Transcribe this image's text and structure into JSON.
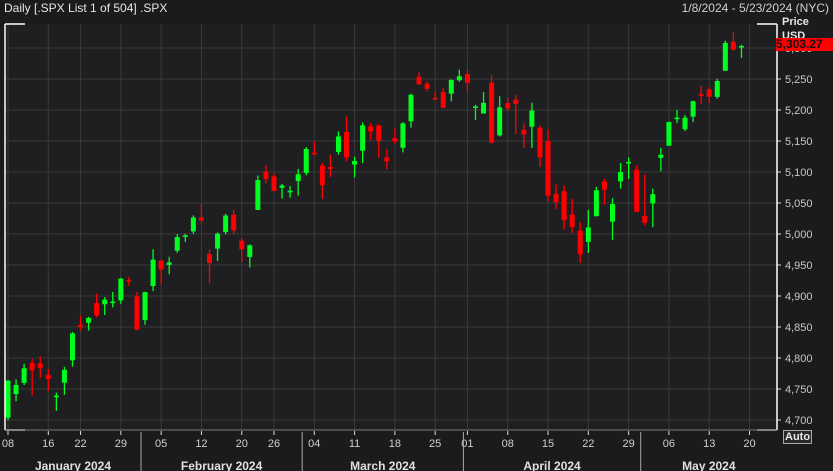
{
  "header": {
    "title": "Daily [.SPX List 1 of 504] .SPX",
    "date_range": "1/8/2024 - 5/23/2024 (NYC)"
  },
  "price_axis": {
    "title": "Price",
    "unit": "USD",
    "last_price": "5,303.27",
    "auto_label": "Auto"
  },
  "colors": {
    "up": "#00ff1e",
    "down": "#ff0000",
    "background": "#1f1f21",
    "grid": "#3a3a3a",
    "last_tag": "#ff0000"
  },
  "chart_data": {
    "type": "candlestick",
    "ylim": [
      4690,
      5330
    ],
    "y_ticks": [
      "4,700",
      "4,750",
      "4,800",
      "4,850",
      "4,900",
      "4,950",
      "5,000",
      "5,050",
      "5,100",
      "5,150",
      "5,200",
      "5,250",
      "5,300"
    ],
    "y_tick_values": [
      4700,
      4750,
      4800,
      4850,
      4900,
      4950,
      5000,
      5050,
      5100,
      5150,
      5200,
      5250,
      5300
    ],
    "x_ticks": [
      {
        "label": "08",
        "date": "2024-01-08"
      },
      {
        "label": "16",
        "date": "2024-01-16"
      },
      {
        "label": "22",
        "date": "2024-01-22"
      },
      {
        "label": "29",
        "date": "2024-01-29"
      },
      {
        "label": "05",
        "date": "2024-02-05"
      },
      {
        "label": "12",
        "date": "2024-02-12"
      },
      {
        "label": "20",
        "date": "2024-02-20"
      },
      {
        "label": "26",
        "date": "2024-02-26"
      },
      {
        "label": "04",
        "date": "2024-03-04"
      },
      {
        "label": "11",
        "date": "2024-03-11"
      },
      {
        "label": "18",
        "date": "2024-03-18"
      },
      {
        "label": "25",
        "date": "2024-03-25"
      },
      {
        "label": "01",
        "date": "2024-04-01"
      },
      {
        "label": "08",
        "date": "2024-04-08"
      },
      {
        "label": "15",
        "date": "2024-04-15"
      },
      {
        "label": "22",
        "date": "2024-04-22"
      },
      {
        "label": "29",
        "date": "2024-04-29"
      },
      {
        "label": "06",
        "date": "2024-05-06"
      },
      {
        "label": "13",
        "date": "2024-05-13"
      },
      {
        "label": "20",
        "date": "2024-05-20"
      }
    ],
    "months": [
      {
        "label": "January 2024",
        "from": "2024-01-08"
      },
      {
        "label": "February 2024",
        "from": "2024-02-01"
      },
      {
        "label": "March 2024",
        "from": "2024-03-01"
      },
      {
        "label": "April 2024",
        "from": "2024-04-01"
      },
      {
        "label": "May 2024",
        "from": "2024-05-01"
      }
    ],
    "candles": [
      [
        "2024-01-08",
        4703.7,
        4764.5,
        4699.8,
        4763.5
      ],
      [
        "2024-01-09",
        4741.9,
        4765.5,
        4730.4,
        4756.5
      ],
      [
        "2024-01-10",
        4759.9,
        4790.8,
        4756.2,
        4783.5
      ],
      [
        "2024-01-11",
        4792.1,
        4798.5,
        4739.6,
        4780.2
      ],
      [
        "2024-01-12",
        4791.2,
        4802.4,
        4768.0,
        4783.8
      ],
      [
        "2024-01-16",
        4772.4,
        4782.3,
        4747.1,
        4766.0
      ],
      [
        "2024-01-17",
        4739.1,
        4744.2,
        4714.8,
        4739.2
      ],
      [
        "2024-01-18",
        4760.1,
        4785.8,
        4740.6,
        4780.9
      ],
      [
        "2024-01-19",
        4796.3,
        4842.1,
        4785.9,
        4839.8
      ],
      [
        "2024-01-22",
        4853.4,
        4868.4,
        4844.1,
        4850.4
      ],
      [
        "2024-01-23",
        4856.8,
        4866.5,
        4844.4,
        4864.6
      ],
      [
        "2024-01-24",
        4888.6,
        4903.7,
        4865.9,
        4868.6
      ],
      [
        "2024-01-25",
        4886.7,
        4898.2,
        4869.3,
        4894.2
      ],
      [
        "2024-01-26",
        4888.9,
        4906.7,
        4881.5,
        4891.0
      ],
      [
        "2024-01-29",
        4892.9,
        4929.3,
        4887.4,
        4927.9
      ],
      [
        "2024-01-30",
        4925.9,
        4931.1,
        4916.3,
        4925.0
      ],
      [
        "2024-01-31",
        4899.2,
        4906.8,
        4845.2,
        4845.7
      ],
      [
        "2024-02-01",
        4861.1,
        4907.0,
        4853.5,
        4906.2
      ],
      [
        "2024-02-02",
        4916.1,
        4975.3,
        4908.0,
        4958.6
      ],
      [
        "2024-02-05",
        4957.2,
        4957.8,
        4918.1,
        4942.8
      ],
      [
        "2024-02-06",
        4950.2,
        4963.1,
        4934.9,
        4954.2
      ],
      [
        "2024-02-07",
        4973.1,
        4999.9,
        4969.7,
        4995.1
      ],
      [
        "2024-02-08",
        4995.2,
        5000.4,
        4987.1,
        4997.9
      ],
      [
        "2024-02-09",
        5004.2,
        5030.1,
        5000.3,
        5026.6
      ],
      [
        "2024-02-12",
        5026.8,
        5048.4,
        5016.7,
        5021.8
      ],
      [
        "2024-02-13",
        4967.9,
        4975.3,
        4920.3,
        4953.2
      ],
      [
        "2024-02-14",
        4976.4,
        5002.5,
        4956.4,
        5000.6
      ],
      [
        "2024-02-15",
        5003.1,
        5032.7,
        4999.4,
        5029.7
      ],
      [
        "2024-02-16",
        5031.1,
        5038.7,
        4999.5,
        5005.6
      ],
      [
        "2024-02-20",
        4989.3,
        4993.6,
        4955.0,
        4975.5
      ],
      [
        "2024-02-21",
        4963.0,
        4983.2,
        4946.0,
        4981.8
      ],
      [
        "2024-02-22",
        5038.8,
        5094.4,
        5038.8,
        5087.0
      ],
      [
        "2024-02-23",
        5100.9,
        5111.1,
        5081.5,
        5088.8
      ],
      [
        "2024-02-26",
        5093.0,
        5097.7,
        5068.9,
        5069.5
      ],
      [
        "2024-02-27",
        5074.6,
        5080.7,
        5057.3,
        5078.2
      ],
      [
        "2024-02-28",
        5067.2,
        5077.4,
        5058.4,
        5069.8
      ],
      [
        "2024-02-29",
        5085.4,
        5105.0,
        5061.9,
        5096.3
      ],
      [
        "2024-03-01",
        5098.5,
        5140.3,
        5094.5,
        5137.1
      ],
      [
        "2024-03-04",
        5131.0,
        5149.7,
        5127.2,
        5130.95
      ],
      [
        "2024-03-05",
        5110.5,
        5114.6,
        5056.8,
        5078.7
      ],
      [
        "2024-03-06",
        5108.0,
        5128.0,
        5092.2,
        5104.8
      ],
      [
        "2024-03-07",
        5132.4,
        5165.6,
        5128.2,
        5157.4
      ],
      [
        "2024-03-08",
        5164.5,
        5189.3,
        5117.5,
        5123.7
      ],
      [
        "2024-03-11",
        5112.0,
        5124.7,
        5091.1,
        5117.9
      ],
      [
        "2024-03-12",
        5134.3,
        5179.9,
        5114.5,
        5175.3
      ],
      [
        "2024-03-13",
        5173.5,
        5179.1,
        5151.9,
        5165.3
      ],
      [
        "2024-03-14",
        5175.1,
        5176.9,
        5123.3,
        5150.5
      ],
      [
        "2024-03-15",
        5123.3,
        5136.9,
        5104.4,
        5117.1
      ],
      [
        "2024-03-18",
        5154.8,
        5170.0,
        5145.5,
        5149.4
      ],
      [
        "2024-03-19",
        5139.1,
        5180.3,
        5131.6,
        5178.5
      ],
      [
        "2024-03-20",
        5181.7,
        5226.2,
        5171.6,
        5224.6
      ],
      [
        "2024-03-21",
        5253.4,
        5261.1,
        5240.7,
        5241.5
      ],
      [
        "2024-03-22",
        5242.5,
        5246.1,
        5229.9,
        5234.2
      ],
      [
        "2024-03-25",
        5219.5,
        5229.1,
        5216.1,
        5218.2
      ],
      [
        "2024-03-26",
        5228.9,
        5235.2,
        5203.4,
        5203.6
      ],
      [
        "2024-03-27",
        5226.3,
        5249.3,
        5213.9,
        5248.5
      ],
      [
        "2024-03-28",
        5248.0,
        5264.9,
        5245.8,
        5254.4
      ],
      [
        "2024-04-01",
        5258.0,
        5264.0,
        5229.2,
        5243.8
      ],
      [
        "2024-04-02",
        5204.3,
        5208.3,
        5184.1,
        5205.8
      ],
      [
        "2024-04-03",
        5194.4,
        5228.8,
        5194.4,
        5211.5
      ],
      [
        "2024-04-04",
        5244.1,
        5256.6,
        5146.1,
        5147.2
      ],
      [
        "2024-04-05",
        5159.0,
        5222.2,
        5157.2,
        5204.3
      ],
      [
        "2024-04-08",
        5211.4,
        5219.6,
        5197.4,
        5202.4
      ],
      [
        "2024-04-09",
        5217.0,
        5224.8,
        5160.8,
        5209.9
      ],
      [
        "2024-04-10",
        5167.9,
        5178.4,
        5138.7,
        5160.6
      ],
      [
        "2024-04-11",
        5173.0,
        5211.8,
        5138.8,
        5199.1
      ],
      [
        "2024-04-12",
        5171.5,
        5175.0,
        5107.9,
        5123.4
      ],
      [
        "2024-04-15",
        5149.7,
        5168.4,
        5052.5,
        5061.8
      ],
      [
        "2024-04-16",
        5064.6,
        5079.8,
        5039.8,
        5051.4
      ],
      [
        "2024-04-17",
        5069.0,
        5078.0,
        5007.3,
        5022.2
      ],
      [
        "2024-04-18",
        5031.5,
        5056.7,
        5001.9,
        5011.1
      ],
      [
        "2024-04-19",
        5005.4,
        5019.0,
        4953.6,
        4967.2
      ],
      [
        "2024-04-22",
        4987.3,
        5038.8,
        4969.4,
        5010.6
      ],
      [
        "2024-04-23",
        5028.9,
        5076.1,
        5028.0,
        5070.6
      ],
      [
        "2024-04-24",
        5084.7,
        5089.5,
        5047.0,
        5071.6
      ],
      [
        "2024-04-25",
        5019.9,
        5057.8,
        4990.6,
        5048.4
      ],
      [
        "2024-04-26",
        5084.9,
        5114.6,
        5073.1,
        5100.0
      ],
      [
        "2024-04-29",
        5114.1,
        5123.5,
        5088.7,
        5116.2
      ],
      [
        "2024-04-30",
        5103.8,
        5110.8,
        5035.3,
        5035.7
      ],
      [
        "2024-05-01",
        5029.0,
        5096.1,
        5013.5,
        5018.4
      ],
      [
        "2024-05-02",
        5049.3,
        5073.2,
        5011.1,
        5064.2
      ],
      [
        "2024-05-03",
        5122.8,
        5139.1,
        5101.2,
        5127.8
      ],
      [
        "2024-05-06",
        5142.4,
        5181.0,
        5142.4,
        5180.7
      ],
      [
        "2024-05-07",
        5187.2,
        5200.2,
        5179.0,
        5187.7
      ],
      [
        "2024-05-08",
        5169.0,
        5192.0,
        5165.9,
        5187.7
      ],
      [
        "2024-05-09",
        5189.3,
        5215.3,
        5180.4,
        5214.1
      ],
      [
        "2024-05-10",
        5225.5,
        5239.7,
        5209.7,
        5222.7
      ],
      [
        "2024-05-13",
        5233.1,
        5237.3,
        5211.2,
        5221.4
      ],
      [
        "2024-05-14",
        5221.1,
        5250.4,
        5218.0,
        5246.7
      ],
      [
        "2024-05-15",
        5263.3,
        5311.8,
        5263.3,
        5308.2
      ],
      [
        "2024-05-16",
        5310.1,
        5325.5,
        5296.2,
        5297.1
      ],
      [
        "2024-05-17",
        5303.1,
        5305.4,
        5283.6,
        5303.27
      ]
    ],
    "candle_fields": [
      "date",
      "open",
      "high",
      "low",
      "close"
    ],
    "grid": true
  }
}
